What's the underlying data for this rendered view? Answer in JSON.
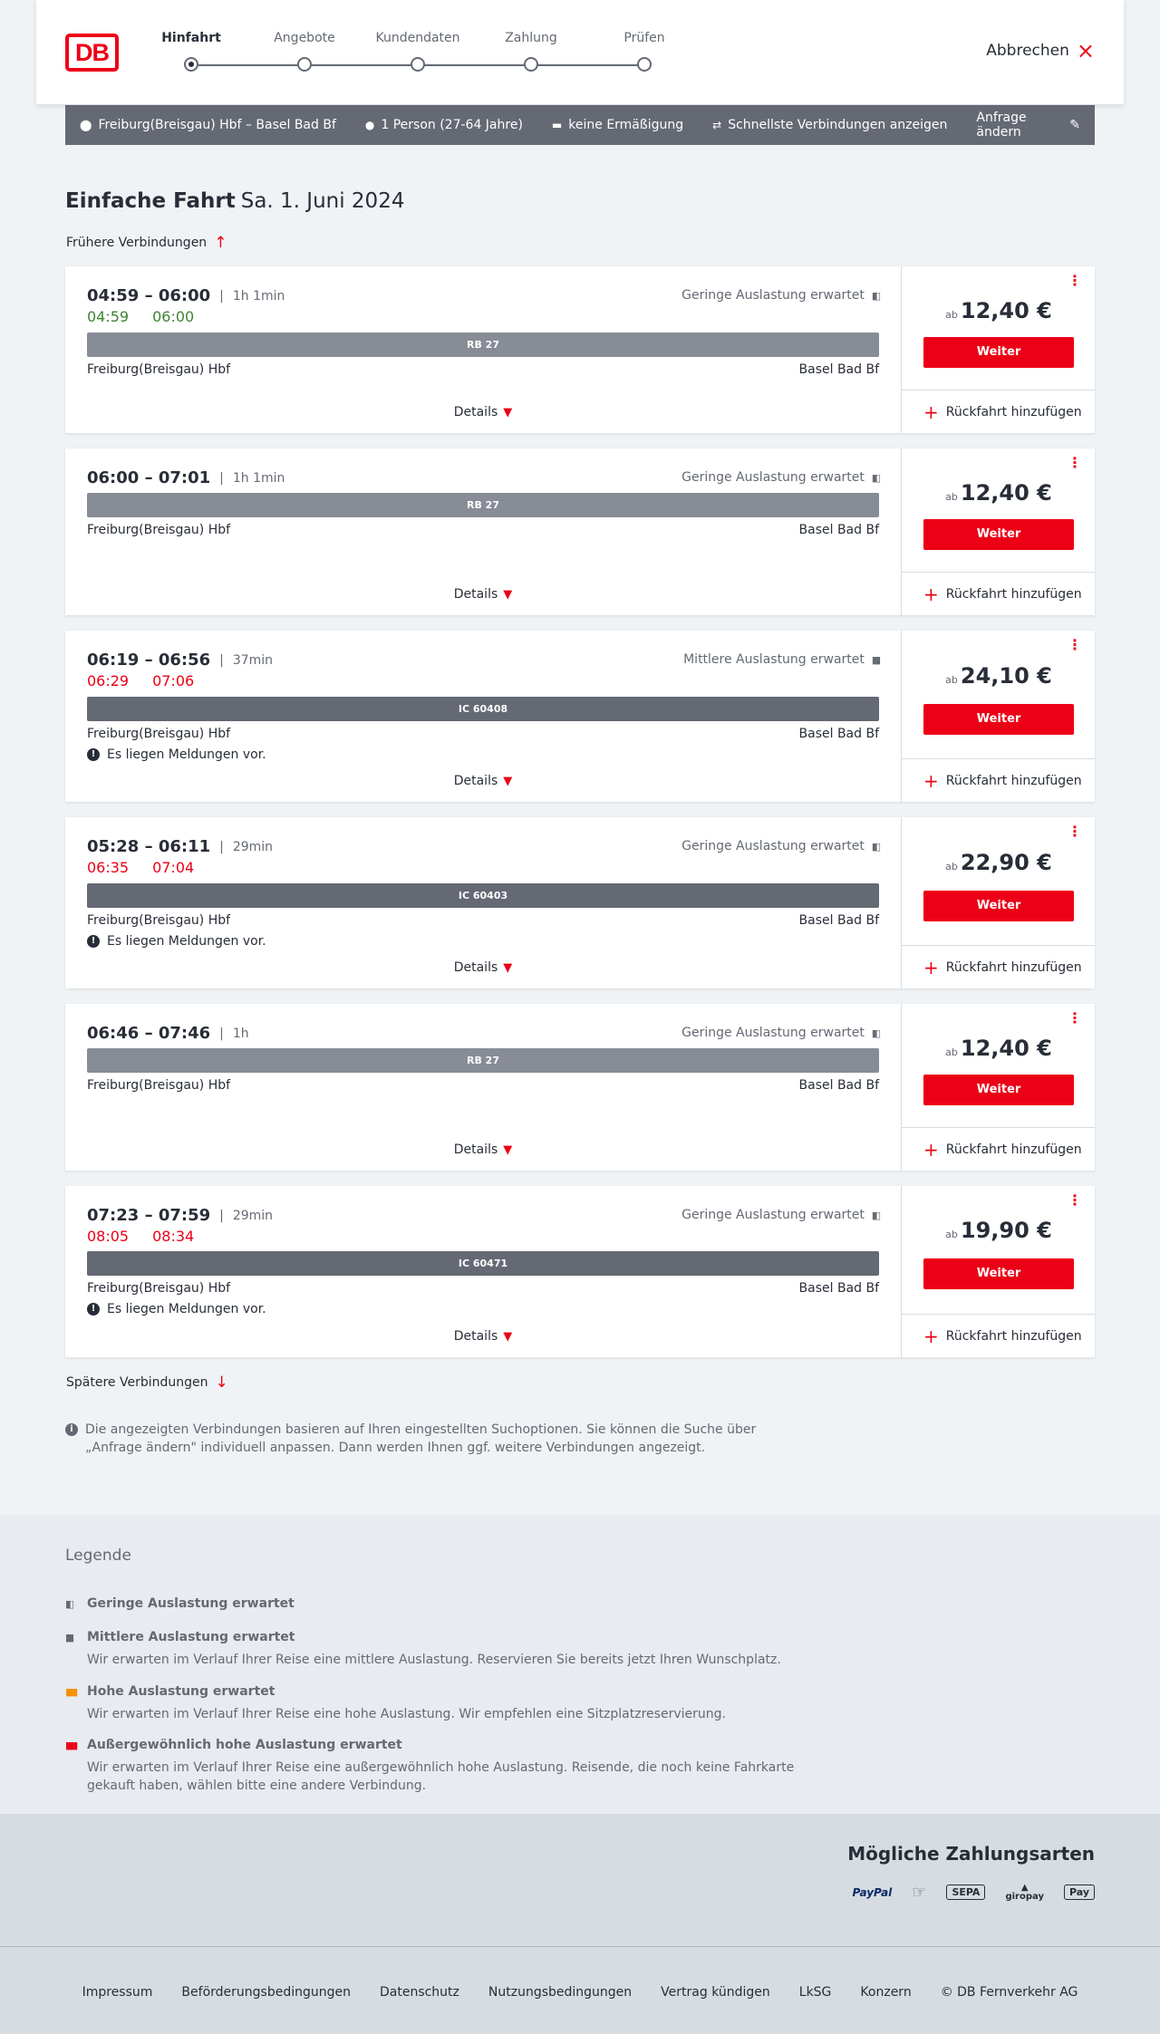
{
  "header": {
    "logo": "DB",
    "steps": [
      {
        "label": "Hinfahrt",
        "active": true
      },
      {
        "label": "Angebote",
        "active": false
      },
      {
        "label": "Kundendaten",
        "active": false
      },
      {
        "label": "Zahlung",
        "active": false
      },
      {
        "label": "Prüfen",
        "active": false
      }
    ],
    "cancel_label": "Abbrechen"
  },
  "query": {
    "route": "Freiburg(Breisgau) Hbf – Basel Bad Bf",
    "travellers": "1 Person (27-64 Jahre)",
    "discount": "keine Ermäßigung",
    "fastest": "Schnellste Verbindungen anzeigen",
    "change": "Anfrage ändern"
  },
  "title": {
    "kind": "Einfache Fahrt",
    "date": "Sa. 1. Juni 2024"
  },
  "earlier_label": "Frühere Verbindungen",
  "later_label": "Spätere Verbindungen",
  "connections": [
    {
      "times": "04:59 – 06:00",
      "duration": "1h 1min",
      "rt_dep": "04:59",
      "rt_arr": "06:00",
      "rt_color": "green",
      "occupancy": "Geringe Auslastung erwartet",
      "train": "RB 27",
      "from": "Freiburg(Breisgau) Hbf",
      "to": "Basel Bad Bf",
      "message": "",
      "price_prefix": "ab",
      "price": "12,40 €"
    },
    {
      "times": "06:00 – 07:01",
      "duration": "1h 1min",
      "rt_dep": "",
      "rt_arr": "",
      "rt_color": "",
      "occupancy": "Geringe Auslastung erwartet",
      "train": "RB 27",
      "from": "Freiburg(Breisgau) Hbf",
      "to": "Basel Bad Bf",
      "message": "",
      "price_prefix": "ab",
      "price": "12,40 €"
    },
    {
      "times": "06:19 – 06:56",
      "duration": "37min",
      "rt_dep": "06:29",
      "rt_arr": "07:06",
      "rt_color": "red",
      "occupancy": "Mittlere Auslastung erwartet",
      "train": "IC 60408",
      "from": "Freiburg(Breisgau) Hbf",
      "to": "Basel Bad Bf",
      "message": "Es liegen Meldungen vor.",
      "price_prefix": "ab",
      "price": "24,10 €"
    },
    {
      "times": "05:28 – 06:11",
      "duration": "29min",
      "rt_dep": "06:35",
      "rt_arr": "07:04",
      "rt_color": "red",
      "occupancy": "Geringe Auslastung erwartet",
      "train": "IC 60403",
      "from": "Freiburg(Breisgau) Hbf",
      "to": "Basel Bad Bf",
      "message": "Es liegen Meldungen vor.",
      "price_prefix": "ab",
      "price": "22,90 €"
    },
    {
      "times": "06:46 – 07:46",
      "duration": "1h",
      "rt_dep": "",
      "rt_arr": "",
      "rt_color": "",
      "occupancy": "Geringe Auslastung erwartet",
      "train": "RB 27",
      "from": "Freiburg(Breisgau) Hbf",
      "to": "Basel Bad Bf",
      "message": "",
      "price_prefix": "ab",
      "price": "12,40 €"
    },
    {
      "times": "07:23 – 07:59",
      "duration": "29min",
      "rt_dep": "08:05",
      "rt_arr": "08:34",
      "rt_color": "red",
      "occupancy": "Geringe Auslastung erwartet",
      "train": "IC 60471",
      "from": "Freiburg(Breisgau) Hbf",
      "to": "Basel Bad Bf",
      "message": "Es liegen Meldungen vor.",
      "price_prefix": "ab",
      "price": "19,90 €"
    }
  ],
  "card_labels": {
    "details": "Details",
    "weiter": "Weiter",
    "return": "Rückfahrt hinzufügen"
  },
  "info_text": "Die angezeigten Verbindungen basieren auf Ihren eingestellten Suchoptionen. Sie können die Suche über „Anfrage ändern\" individuell anpassen. Dann werden Ihnen ggf. weitere Verbindungen angezeigt.",
  "legend": {
    "title": "Legende",
    "items": [
      {
        "title": "Geringe Auslastung erwartet",
        "text": "",
        "color": "#646973"
      },
      {
        "title": "Mittlere Auslastung erwartet",
        "text": "Wir erwarten im Verlauf Ihrer Reise eine mittlere Auslastung. Reservieren Sie bereits jetzt Ihren Wunschplatz.",
        "color": "#646973"
      },
      {
        "title": "Hohe Auslastung erwartet",
        "text": "Wir erwarten im Verlauf Ihrer Reise eine hohe Auslastung. Wir empfehlen eine Sitzplatzreservierung.",
        "color": "#f39200"
      },
      {
        "title": "Außergewöhnlich hohe Auslastung erwartet",
        "text": "Wir erwarten im Verlauf Ihrer Reise eine außergewöhnlich hohe Auslastung. Reisende, die noch keine Fahrkarte gekauft haben, wählen bitte eine andere Verbindung.",
        "color": "#ec0016"
      }
    ]
  },
  "payment": {
    "title": "Mögliche Zahlungsarten",
    "methods": [
      "PayPal",
      "Kreditkarte",
      "SEPA",
      "giropay",
      "Apple Pay"
    ],
    "labels": {
      "paypal": "PayPal",
      "sepa": "SEPA",
      "giropay": "giropay",
      "applepay": "Pay"
    }
  },
  "footer": {
    "links": [
      "Impressum",
      "Beförderungsbedingungen",
      "Datenschutz",
      "Nutzungsbedingungen",
      "Vertrag kündigen",
      "LkSG",
      "Konzern",
      "© DB Fernverkehr AG"
    ]
  }
}
